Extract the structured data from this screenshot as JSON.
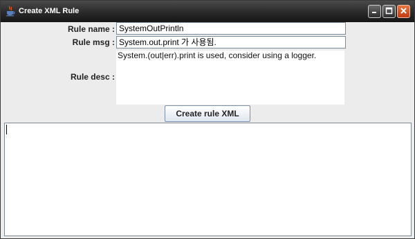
{
  "window": {
    "title": "Create XML Rule",
    "icons": {
      "app": "java-cup-icon",
      "minimize": "minimize-icon",
      "maximize": "maximize-icon",
      "close": "close-icon"
    },
    "colors": {
      "close_button": "#d9521f",
      "titlebar": "#2a2a2a"
    }
  },
  "form": {
    "rule_name_label": "Rule name :",
    "rule_name_value": "SystemOutPrintln",
    "rule_msg_label": "Rule msg :",
    "rule_msg_value": "System.out.print 가 사용됨.",
    "rule_desc_label": "Rule desc :",
    "rule_desc_value": "System.(out|err).print is used, consider using a logger."
  },
  "actions": {
    "create_button_label": "Create rule XML"
  },
  "output": {
    "text": ""
  }
}
